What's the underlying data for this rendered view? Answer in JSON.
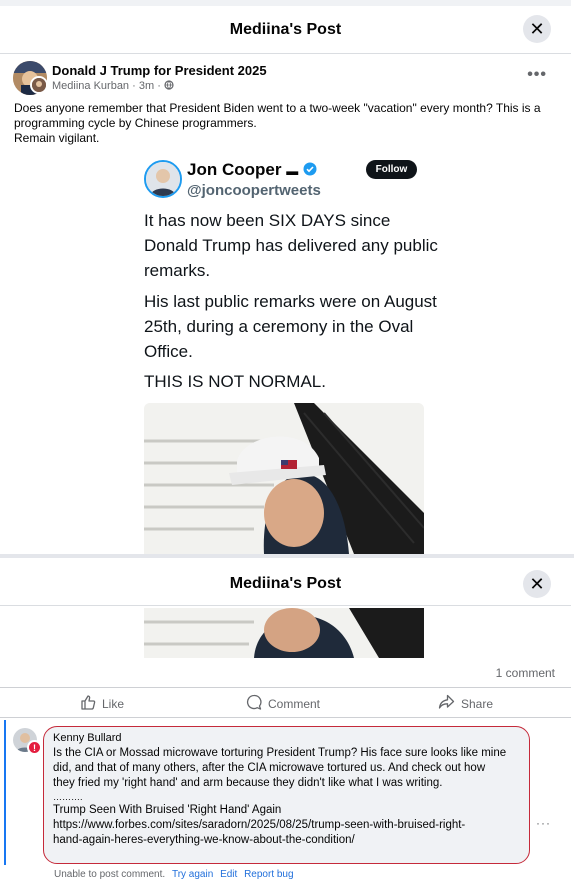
{
  "modal": {
    "title": "Mediina's Post",
    "close_icon": "close-icon"
  },
  "post": {
    "page_name": "Donald J Trump for President 2025",
    "author": "Mediina Kurban",
    "time": "3m",
    "privacy_icon": "globe-icon",
    "text_lines": [
      "Does anyone remember that President Biden went to a two-week \"vacation\" every month? This is a",
      "programming cycle by Chinese programmers.",
      "Remain vigilant."
    ]
  },
  "tweet": {
    "name": "Jon Cooper",
    "flag": "🇺🇸",
    "verified_icon": "verified-badge-icon",
    "handle": "@joncoopertweets",
    "follow_label": "Follow",
    "paragraphs": [
      "It has now been SIX DAYS since Donald Trump has delivered any public remarks.",
      "His last public remarks were on August 25th, during a ceremony in the Oval Office.",
      "THIS IS NOT NORMAL."
    ]
  },
  "stats": {
    "comment_count": "1 comment"
  },
  "actions": {
    "like_label": "Like",
    "comment_label": "Comment",
    "share_label": "Share"
  },
  "comment": {
    "author": "Kenny Bullard",
    "body_lines": [
      "Is the CIA or Mossad microwave torturing President Trump? His face sure looks like mine",
      "did, and that of many others, after the CIA microwave tortured us. And check out how",
      "they fried my 'right hand' and arm because they didn't like what I was writing.",
      "……….",
      "Trump Seen With Bruised 'Right Hand' Again",
      "https://www.forbes.com/sites/saradorn/2025/08/25/trump-seen-with-bruised-right-",
      "hand-again-heres-everything-we-know-about-the-condition/"
    ],
    "error_icon": "error-icon",
    "status_text": "Unable to post comment.",
    "try_again": "Try again",
    "edit": "Edit",
    "report": "Report bug"
  },
  "colors": {
    "error_red": "#c52a3a",
    "link_blue": "#216fdb",
    "verified_blue": "#1d9bf0"
  }
}
